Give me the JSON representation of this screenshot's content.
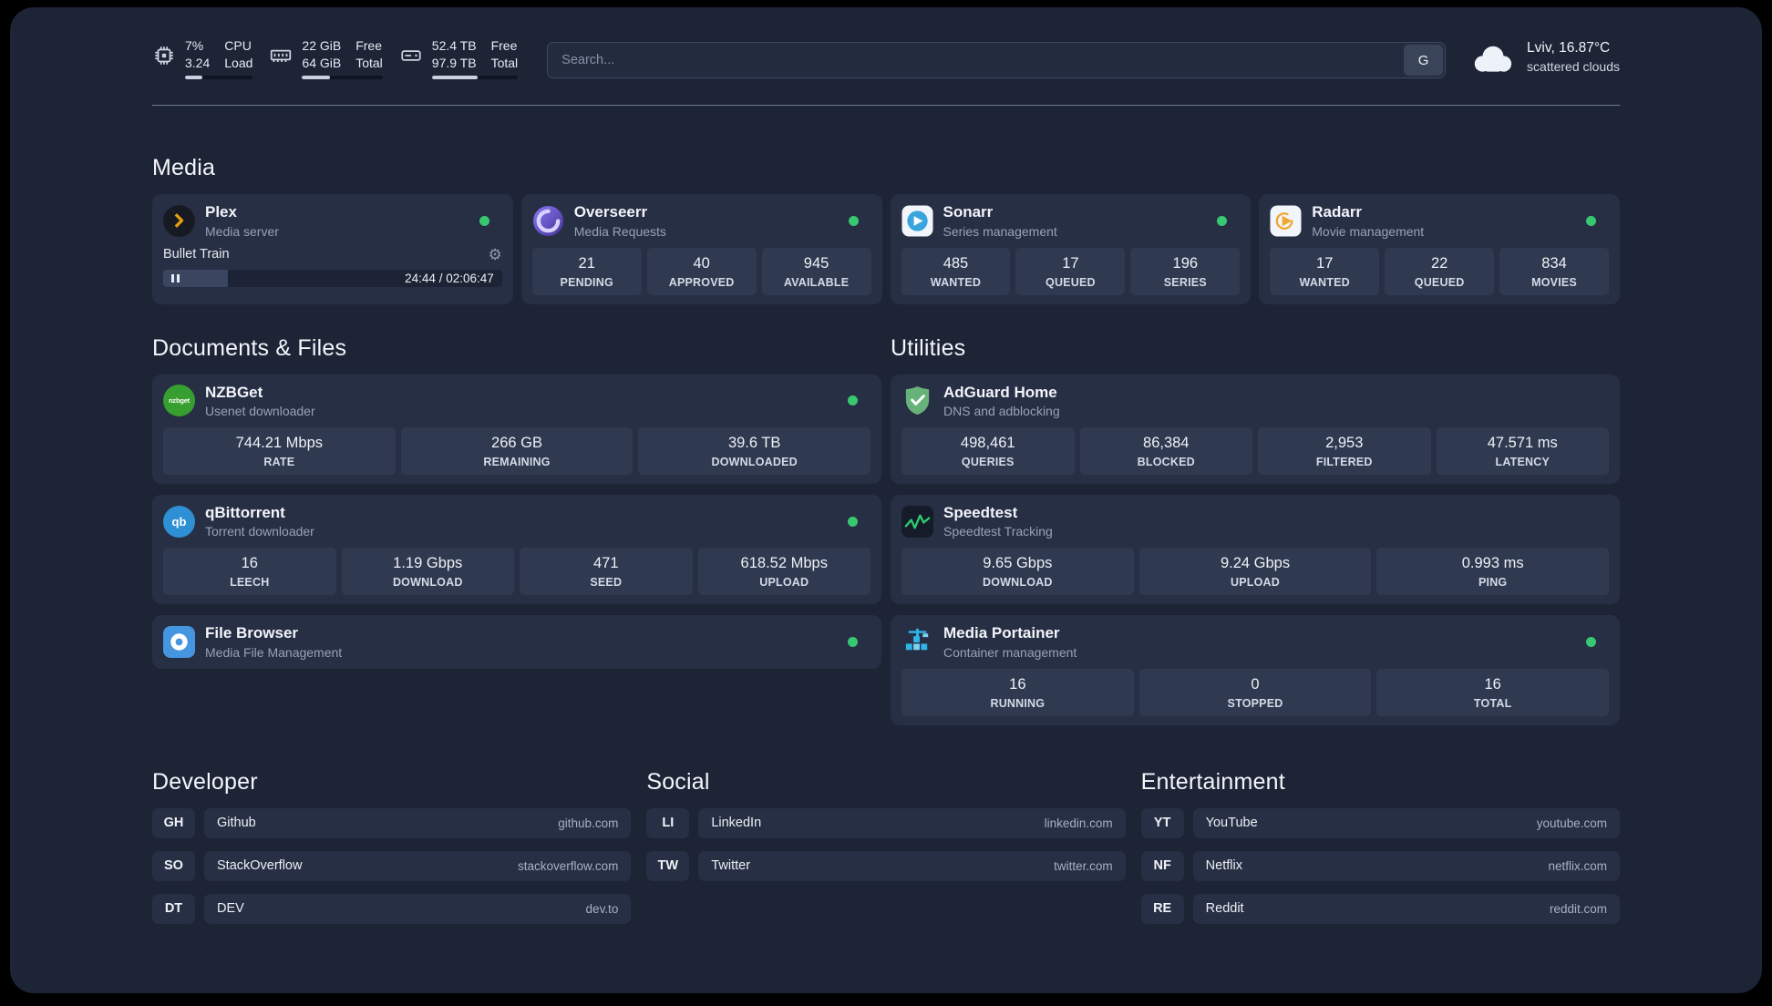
{
  "topbar": {
    "cpu": {
      "value1": "7%",
      "value2": "3.24",
      "label1": "CPU",
      "label2": "Load",
      "bar_percent": 25
    },
    "memory": {
      "value1": "22 GiB",
      "value2": "64 GiB",
      "label1": "Free",
      "label2": "Total",
      "bar_percent": 35
    },
    "disk": {
      "value1": "52.4 TB",
      "value2": "97.9 TB",
      "label1": "Free",
      "label2": "Total",
      "bar_percent": 53
    },
    "search": {
      "placeholder": "Search...",
      "engine_button": "G"
    },
    "weather": {
      "location": "Lviv, 16.87°C",
      "condition": "scattered clouds"
    }
  },
  "sections": {
    "media": "Media",
    "documents": "Documents & Files",
    "utilities": "Utilities",
    "developer": "Developer",
    "social": "Social",
    "entertainment": "Entertainment"
  },
  "apps": {
    "plex": {
      "name": "Plex",
      "subtitle": "Media server",
      "now_playing": "Bullet Train",
      "time": "24:44 / 02:06:47",
      "progress_percent": 19
    },
    "overseerr": {
      "name": "Overseerr",
      "subtitle": "Media Requests",
      "stats": [
        {
          "value": "21",
          "label": "PENDING"
        },
        {
          "value": "40",
          "label": "APPROVED"
        },
        {
          "value": "945",
          "label": "AVAILABLE"
        }
      ]
    },
    "sonarr": {
      "name": "Sonarr",
      "subtitle": "Series management",
      "stats": [
        {
          "value": "485",
          "label": "WANTED"
        },
        {
          "value": "17",
          "label": "QUEUED"
        },
        {
          "value": "196",
          "label": "SERIES"
        }
      ]
    },
    "radarr": {
      "name": "Radarr",
      "subtitle": "Movie management",
      "stats": [
        {
          "value": "17",
          "label": "WANTED"
        },
        {
          "value": "22",
          "label": "QUEUED"
        },
        {
          "value": "834",
          "label": "MOVIES"
        }
      ]
    },
    "nzbget": {
      "name": "NZBGet",
      "subtitle": "Usenet downloader",
      "icon_text": "nzbget",
      "stats": [
        {
          "value": "744.21 Mbps",
          "label": "RATE"
        },
        {
          "value": "266 GB",
          "label": "REMAINING"
        },
        {
          "value": "39.6 TB",
          "label": "DOWNLOADED"
        }
      ]
    },
    "qbittorrent": {
      "name": "qBittorrent",
      "subtitle": "Torrent downloader",
      "icon_text": "qb",
      "stats": [
        {
          "value": "16",
          "label": "LEECH"
        },
        {
          "value": "1.19 Gbps",
          "label": "DOWNLOAD"
        },
        {
          "value": "471",
          "label": "SEED"
        },
        {
          "value": "618.52 Mbps",
          "label": "UPLOAD"
        }
      ]
    },
    "filebrowser": {
      "name": "File Browser",
      "subtitle": "Media File Management"
    },
    "adguard": {
      "name": "AdGuard Home",
      "subtitle": "DNS and adblocking",
      "stats": [
        {
          "value": "498,461",
          "label": "QUERIES"
        },
        {
          "value": "86,384",
          "label": "BLOCKED"
        },
        {
          "value": "2,953",
          "label": "FILTERED"
        },
        {
          "value": "47.571 ms",
          "label": "LATENCY"
        }
      ]
    },
    "speedtest": {
      "name": "Speedtest",
      "subtitle": "Speedtest Tracking",
      "stats": [
        {
          "value": "9.65 Gbps",
          "label": "DOWNLOAD"
        },
        {
          "value": "9.24 Gbps",
          "label": "UPLOAD"
        },
        {
          "value": "0.993 ms",
          "label": "PING"
        }
      ]
    },
    "portainer": {
      "name": "Media Portainer",
      "subtitle": "Container management",
      "stats": [
        {
          "value": "16",
          "label": "RUNNING"
        },
        {
          "value": "0",
          "label": "STOPPED"
        },
        {
          "value": "16",
          "label": "TOTAL"
        }
      ]
    }
  },
  "bookmarks": {
    "developer": [
      {
        "abbr": "GH",
        "name": "Github",
        "url": "github.com"
      },
      {
        "abbr": "SO",
        "name": "StackOverflow",
        "url": "stackoverflow.com"
      },
      {
        "abbr": "DT",
        "name": "DEV",
        "url": "dev.to"
      }
    ],
    "social": [
      {
        "abbr": "LI",
        "name": "LinkedIn",
        "url": "linkedin.com"
      },
      {
        "abbr": "TW",
        "name": "Twitter",
        "url": "twitter.com"
      }
    ],
    "entertainment": [
      {
        "abbr": "YT",
        "name": "YouTube",
        "url": "youtube.com"
      },
      {
        "abbr": "NF",
        "name": "Netflix",
        "url": "netflix.com"
      },
      {
        "abbr": "RE",
        "name": "Reddit",
        "url": "reddit.com"
      }
    ]
  },
  "colors": {
    "status_online": "#37c871",
    "accent_plex": "#e5a00d"
  }
}
